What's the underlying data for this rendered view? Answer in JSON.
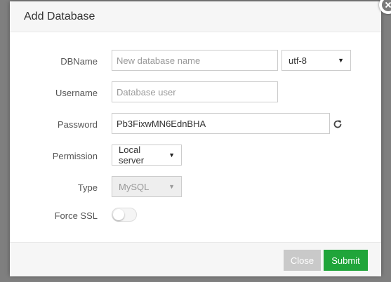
{
  "dialog": {
    "title": "Add Database"
  },
  "form": {
    "dbname": {
      "label": "DBName",
      "placeholder": "New database name",
      "value": ""
    },
    "charset": {
      "selected": "utf-8"
    },
    "username": {
      "label": "Username",
      "placeholder": "Database user",
      "value": ""
    },
    "password": {
      "label": "Password",
      "value": "Pb3FixwMN6EdnBHA"
    },
    "permission": {
      "label": "Permission",
      "selected": "Local server"
    },
    "type": {
      "label": "Type",
      "selected": "MySQL",
      "disabled": true
    },
    "force_ssl": {
      "label": "Force SSL",
      "enabled": false
    }
  },
  "footer": {
    "close_label": "Close",
    "submit_label": "Submit"
  },
  "colors": {
    "submit": "#20a53a",
    "close": "#c9c9c9",
    "header_bg": "#f6f6f6"
  },
  "icons": {
    "refresh": "refresh-icon",
    "close": "close-icon",
    "dropdown": "chevron-down-icon"
  }
}
